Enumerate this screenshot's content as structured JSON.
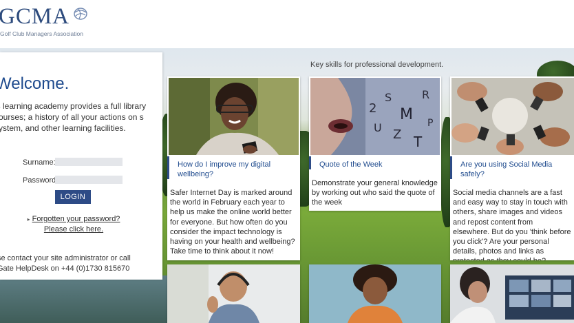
{
  "header": {
    "logo_text": "GCMA",
    "logo_subtitle": "Golf Club Managers Association"
  },
  "login": {
    "heading": "Welcome.",
    "intro": "is learning academy provides a full library courses; a history of all your actions on s system, and other learning facilities.",
    "surname_label": "Surname:",
    "password_label": "Password:",
    "surname_value": "",
    "password_value": "",
    "login_button": "LOGIN",
    "forgot_link": "Forgotten your password?",
    "click_here": "Please click here.",
    "contact_line1": "se contact your site administrator or call",
    "contact_line2": "Gate HelpDesk on +44 (0)1730 815670"
  },
  "tagline": "Key skills for professional development.",
  "cards": [
    {
      "title": "How do I improve my digital wellbeing?",
      "body": "Safer Internet Day is marked around the world in February each year to help us make the online world better for everyone. But how often do you consider the impact technology is having on your health and wellbeing? Take time to think about it now!",
      "image": "woman-smiling-with-phone"
    },
    {
      "title": "Quote of the Week",
      "body": "Demonstrate your general knowledge by working out who said the quote of the week",
      "image": "lips-with-letters"
    },
    {
      "title": "Are you using Social Media safely?",
      "body": "Social media channels are a fast and easy way to stay in touch with others, share images and videos and repost content from elsewhere. But do you 'think before you click'? Are your personal details, photos and links as protected as they could be?",
      "image": "hands-holding-phones"
    }
  ],
  "bottom_cards": [
    {
      "image": "man-headset-thumbs-up"
    },
    {
      "image": "woman-orange-top"
    },
    {
      "image": "video-call-laptop"
    }
  ],
  "colors": {
    "brand_blue": "#2d4b86",
    "heading_blue": "#1f4b8e"
  }
}
